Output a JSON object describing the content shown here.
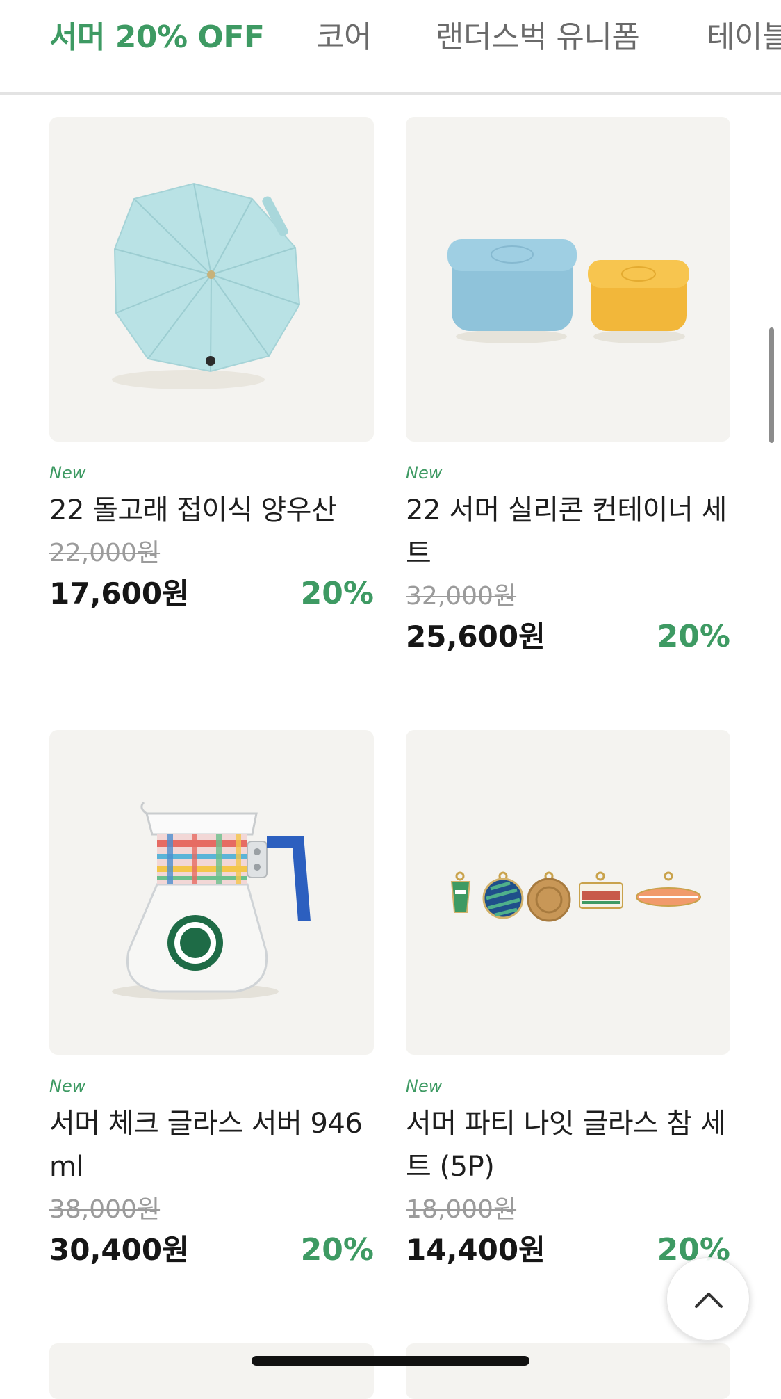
{
  "tabs": [
    {
      "label": "서머 20% OFF",
      "active": true
    },
    {
      "label": "코어",
      "active": false
    },
    {
      "label": "랜더스벅 유니폼",
      "active": false
    },
    {
      "label": "테이블",
      "active": false
    }
  ],
  "products": [
    {
      "badge": "New",
      "name": "22 돌고래 접이식 양우산",
      "original_price": "22,000원",
      "price": "17,600원",
      "discount": "20%",
      "image_icon": "umbrella-icon"
    },
    {
      "badge": "New",
      "name": "22 서머 실리콘 컨테이너 세트",
      "original_price": "32,000원",
      "price": "25,600원",
      "discount": "20%",
      "image_icon": "container-set-icon"
    },
    {
      "badge": "New",
      "name": "서머 체크 글라스 서버 946 ml",
      "original_price": "38,000원",
      "price": "30,400원",
      "discount": "20%",
      "image_icon": "glass-server-icon"
    },
    {
      "badge": "New",
      "name": "서머 파티 나잇 글라스 참 세트 (5P)",
      "original_price": "18,000원",
      "price": "14,400원",
      "discount": "20%",
      "image_icon": "glass-charms-icon"
    }
  ],
  "scroll_top_button": {
    "icon": "chevron-up-icon"
  },
  "colors": {
    "accent": "#3e9a63",
    "card_bg": "#f4f3f0",
    "strike": "#9b9b9b"
  }
}
